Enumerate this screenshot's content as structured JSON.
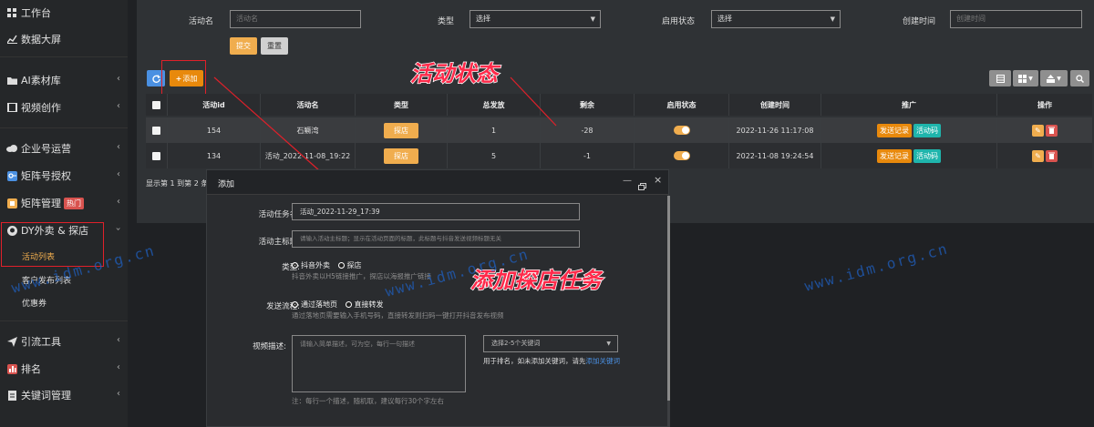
{
  "sidebar": {
    "items": [
      {
        "icon": "grid-icon",
        "label": "工作台"
      },
      {
        "icon": "chart-icon",
        "label": "数据大屏"
      },
      {
        "icon": "folder-icon",
        "label": "AI素材库"
      },
      {
        "icon": "film-icon",
        "label": "视频创作"
      },
      {
        "icon": "cloud-icon",
        "label": "企业号运营"
      },
      {
        "icon": "key-icon",
        "label": "矩阵号授权"
      },
      {
        "icon": "box-icon",
        "label": "矩阵管理",
        "badge": "热门"
      },
      {
        "icon": "github-icon",
        "label": "DY外卖 & 探店"
      },
      {
        "icon": "send-icon",
        "label": "引流工具"
      },
      {
        "icon": "rank-icon",
        "label": "排名"
      },
      {
        "icon": "doc-icon",
        "label": "关键词管理"
      }
    ],
    "sub_items": [
      "活动列表",
      "客户发布列表",
      "优惠券"
    ]
  },
  "filters": {
    "name_label": "活动名",
    "name_placeholder": "活动名",
    "type_label": "类型",
    "type_value": "选择",
    "status_label": "启用状态",
    "status_value": "选择",
    "created_label": "创建时间",
    "created_placeholder": "创建时间",
    "submit": "提交",
    "reset": "重置"
  },
  "toolbar": {
    "add": "添加"
  },
  "table": {
    "headers": [
      "活动id",
      "活动名",
      "类型",
      "总发放",
      "剩余",
      "启用状态",
      "创建时间",
      "推广",
      "操作"
    ],
    "rows": [
      {
        "id": "154",
        "name": "石鳜湾",
        "type": "探店",
        "total": "1",
        "remain": "-28",
        "enabled": true,
        "created": "2022-11-26 11:17:08",
        "promo1": "发送记录",
        "promo2": "活动码"
      },
      {
        "id": "134",
        "name": "活动_2022-11-08_19:22",
        "type": "探店",
        "total": "5",
        "remain": "-1",
        "enabled": true,
        "created": "2022-11-08 19:24:54",
        "promo1": "发送记录",
        "promo2": "活动码"
      }
    ],
    "footer": "显示第 1 到第 2 条"
  },
  "modal": {
    "title": "添加",
    "task_name_label": "活动任务名:",
    "task_name_value": "活动_2022-11-29_17:39",
    "subtitle_label": "活动主标题:",
    "subtitle_placeholder": "请输入活动主标题；显示在活动页面的标题，此标题与抖音发送视频标题无关",
    "type_label": "类型:",
    "type_opt1": "抖音外卖",
    "type_opt2": "探店",
    "type_help": "抖音外卖以H5链接推广，探店以海报推广链接",
    "flow_label": "发送流程:",
    "flow_opt1": "通过落地页",
    "flow_opt2": "直接转发",
    "flow_help": "通过落地页需要输入手机号码，直接转发则扫码一键打开抖音发布视频",
    "desc_label": "视频描述:",
    "desc_placeholder": "请输入简单描述，可为空，每行一句描述",
    "kw_placeholder": "选择2-5个关键词",
    "kw_help_prefix": "用于排名，如未添加关键词，请先",
    "kw_help_link": "添加关键词",
    "desc_note": "注：每行一个描述，随机取，建议每行30个字左右"
  },
  "annotations": {
    "status": "活动状态",
    "add_task": "添加探店任务"
  },
  "watermark": "www.idm.org.cn",
  "colors": {
    "orange": "#f0ad4e",
    "dark_orange": "#e8890c",
    "teal": "#1fb5ac",
    "red": "#d9534f",
    "blue": "#4a90e2",
    "annotation": "#ff2a4a"
  }
}
